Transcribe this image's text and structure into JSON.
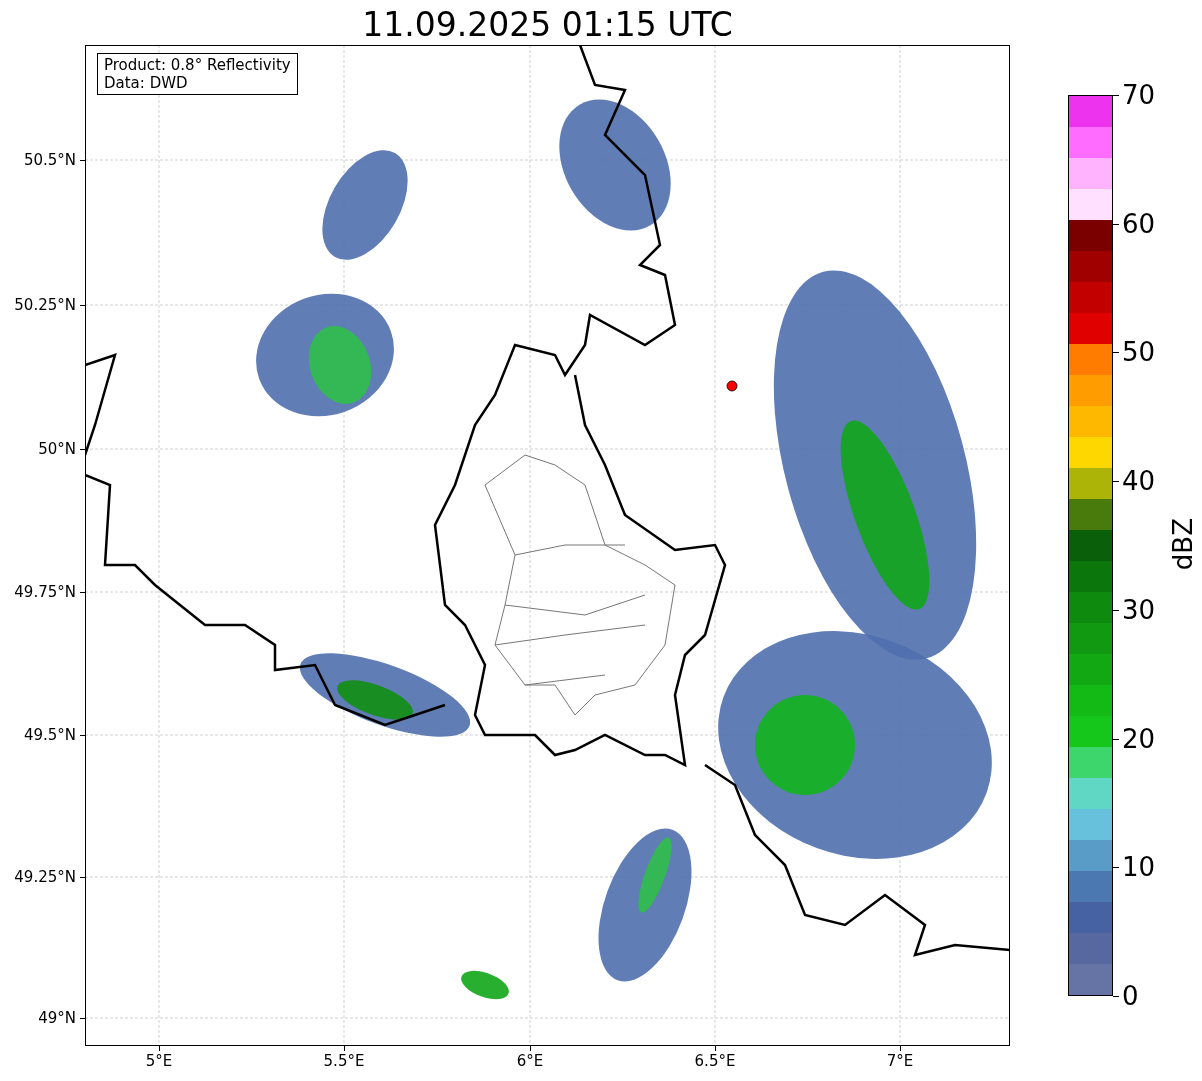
{
  "title": "11.09.2025 01:15 UTC",
  "info_box": [
    "Product: 0.8° Reflectivity",
    "Data: DWD"
  ],
  "lat_ticks": [
    "50.5°N",
    "50.25°N",
    "50°N",
    "49.75°N",
    "49.5°N",
    "49.25°N",
    "49°N"
  ],
  "lon_ticks": [
    "5°E",
    "5.5°E",
    "6°E",
    "6.5°E",
    "7°E"
  ],
  "colorbar": {
    "label": "dBZ",
    "ticks": [
      "70",
      "60",
      "50",
      "40",
      "30",
      "20",
      "10",
      "0"
    ]
  }
}
